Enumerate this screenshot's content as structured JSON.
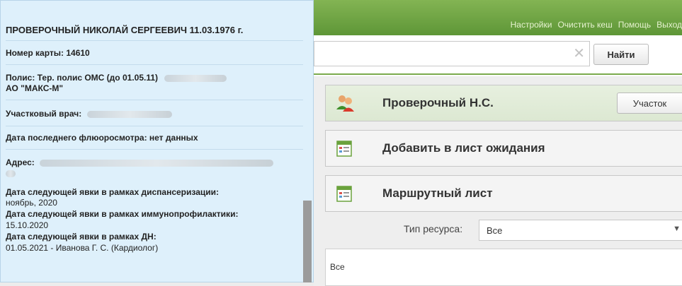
{
  "header": {
    "links": [
      "Настройки",
      "Очистить кеш",
      "Помощь",
      "Выход"
    ]
  },
  "search": {
    "value": "",
    "clear_label": "✕",
    "button_label": "Найти"
  },
  "patient_popup": {
    "name": "ПРОВЕРОЧНЫЙ НИКОЛАЙ СЕРГЕЕВИЧ 11.03.1976 г.",
    "card_number": "Номер карты: 14610",
    "policy_line1": "Полис: Тер. полис ОМС (до 01.05.11)",
    "policy_line2": "АО \"МАКС-М\"",
    "doctor": "Участковый врач:",
    "fluoro": "Дата последнего флюоросмотра: нет данных",
    "address": "Адрес:",
    "disp_label": "Дата следующей явки в рамках диспансеризации:",
    "disp_value": "ноябрь, 2020",
    "immuno_label": "Дата следующей явки в рамках иммунопрофилактики:",
    "immuno_value": "15.10.2020",
    "dn_label": "Дата следующей явки  в рамках ДН:",
    "dn_value": "01.05.2021 - Иванова Г. С. (Кардиолог)"
  },
  "panels": [
    {
      "title": "Проверочный Н.С.",
      "icon": "patient-icon"
    },
    {
      "title": "Добавить в лист ожидания",
      "icon": "calendar-list-icon"
    },
    {
      "title": "Маршрутный лист",
      "icon": "calendar-list-icon"
    }
  ],
  "uchastok_button": "Участок",
  "resource": {
    "label": "Тип ресурса:",
    "selected": "Все"
  },
  "all_list": {
    "text": "Все"
  },
  "colors": {
    "topbar": "#6ea443",
    "popup_bg": "#def0fb",
    "active_panel": "#e3eed9"
  }
}
